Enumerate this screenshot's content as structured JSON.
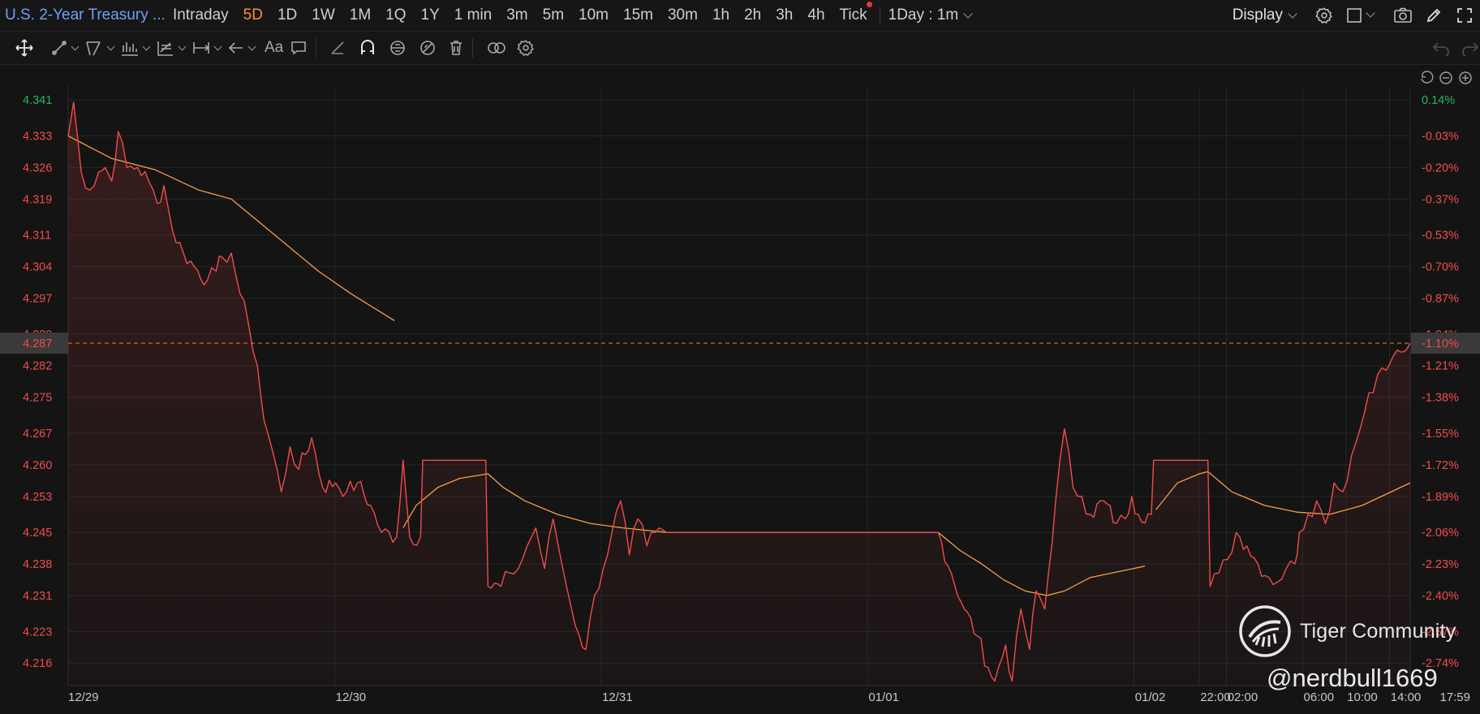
{
  "header": {
    "title": "U.S. 2-Year Treasury ...",
    "timeframes": [
      {
        "label": "Intraday",
        "active": false
      },
      {
        "label": "5D",
        "active": true
      },
      {
        "label": "1D",
        "active": false
      },
      {
        "label": "1W",
        "active": false
      },
      {
        "label": "1M",
        "active": false
      },
      {
        "label": "1Q",
        "active": false
      },
      {
        "label": "1Y",
        "active": false
      },
      {
        "label": "1 min",
        "active": false
      },
      {
        "label": "3m",
        "active": false
      },
      {
        "label": "5m",
        "active": false
      },
      {
        "label": "10m",
        "active": false
      },
      {
        "label": "15m",
        "active": false
      },
      {
        "label": "30m",
        "active": false
      },
      {
        "label": "1h",
        "active": false
      },
      {
        "label": "2h",
        "active": false
      },
      {
        "label": "3h",
        "active": false
      },
      {
        "label": "4h",
        "active": false
      },
      {
        "label": "Tick",
        "active": false
      }
    ],
    "period_select": "1Day : 1m",
    "display_label": "Display"
  },
  "toolbar": {
    "text_tool": "Aa",
    "icons": [
      "move-icon",
      "line-tool-icon",
      "channel-tool-icon",
      "pattern-tool-icon",
      "fib-tool-icon",
      "measure-tool-icon",
      "arrow-tool-icon",
      "text-tool-icon",
      "comment-icon",
      "pencil-icon",
      "magnet-icon",
      "lock-icon",
      "hide-icon",
      "trash-icon",
      "link-icon",
      "settings-icon",
      "undo-icon",
      "redo-icon"
    ]
  },
  "colors": {
    "up": "#25b85a",
    "down": "#f24b4b",
    "avg_line": "#f5a04a",
    "background": "#141414",
    "grid": "#262626",
    "current_price_line": "#f57a3d"
  },
  "chart_data": {
    "type": "line",
    "instrument": "U.S. 2-Year Treasury",
    "y_left_ticks": [
      "4.341",
      "4.333",
      "4.326",
      "4.319",
      "4.311",
      "4.304",
      "4.297",
      "4.289",
      "4.282",
      "4.275",
      "4.267",
      "4.260",
      "4.253",
      "4.245",
      "4.238",
      "4.231",
      "4.223",
      "4.216"
    ],
    "y_right_ticks": [
      "0.14%",
      "-0.03%",
      "-0.20%",
      "-0.37%",
      "-0.53%",
      "-0.70%",
      "-0.87%",
      "-1.04%",
      "-1.21%",
      "-1.38%",
      "-1.55%",
      "-1.72%",
      "-1.89%",
      "-2.06%",
      "-2.23%",
      "-2.40%",
      "-2.57%",
      "-2.74%"
    ],
    "ylim": [
      4.211,
      4.343
    ],
    "current_price": {
      "value": 4.287,
      "label": "4.287",
      "pct": "-1.10%"
    },
    "x_labels": [
      "12/29",
      "12/30",
      "12/31",
      "01/01",
      "01/02",
      "22:00",
      "02:00",
      "06:00",
      "10:00",
      "14:00",
      "17:59"
    ],
    "grid": true,
    "price_series": [
      [
        0,
        4.333
      ],
      [
        0.5,
        4.3405
      ],
      [
        1.2,
        4.325
      ],
      [
        2,
        4.321
      ],
      [
        2.8,
        4.325
      ],
      [
        3.4,
        4.326
      ],
      [
        4,
        4.323
      ],
      [
        4.6,
        4.334
      ],
      [
        5.4,
        4.326
      ],
      [
        6.4,
        4.326
      ],
      [
        7.4,
        4.323
      ],
      [
        8.2,
        4.318
      ],
      [
        8.8,
        4.322
      ],
      [
        9.6,
        4.312
      ],
      [
        10.6,
        4.307
      ],
      [
        11.6,
        4.304
      ],
      [
        12.8,
        4.301
      ],
      [
        13.6,
        4.303
      ],
      [
        14.2,
        4.306
      ],
      [
        15,
        4.307
      ],
      [
        15.8,
        4.298
      ],
      [
        16.6,
        4.291
      ],
      [
        17.4,
        4.282
      ],
      [
        18,
        4.27
      ],
      [
        18.8,
        4.263
      ],
      [
        19.6,
        4.254
      ],
      [
        20.4,
        4.264
      ],
      [
        21.2,
        4.259
      ],
      [
        22.4,
        4.266
      ],
      [
        23.4,
        4.255
      ],
      [
        24.6,
        4.256
      ],
      [
        25.6,
        4.254
      ],
      [
        26.6,
        4.256
      ],
      [
        27.8,
        4.251
      ],
      [
        28.8,
        4.245
      ],
      [
        30.2,
        4.244
      ],
      [
        30.8,
        4.261
      ],
      [
        31.4,
        4.244
      ],
      [
        32.4,
        4.244
      ],
      [
        32.6,
        4.261
      ],
      [
        38.4,
        4.261
      ],
      [
        38.6,
        4.233
      ],
      [
        39.8,
        4.233
      ],
      [
        40.6,
        4.236
      ],
      [
        41.4,
        4.237
      ],
      [
        42.2,
        4.242
      ],
      [
        43,
        4.246
      ],
      [
        43.8,
        4.237
      ],
      [
        44.6,
        4.248
      ],
      [
        45.4,
        4.238
      ],
      [
        46.2,
        4.229
      ],
      [
        47,
        4.222
      ],
      [
        47.6,
        4.219
      ],
      [
        48.4,
        4.231
      ],
      [
        49.2,
        4.237
      ],
      [
        50,
        4.245
      ],
      [
        50.8,
        4.252
      ],
      [
        51.6,
        4.24
      ],
      [
        52.4,
        4.248
      ],
      [
        53.2,
        4.242
      ],
      [
        54,
        4.245
      ],
      [
        55,
        4.245
      ],
      [
        80,
        4.245
      ],
      [
        81.2,
        4.236
      ],
      [
        82.4,
        4.228
      ],
      [
        83.6,
        4.222
      ],
      [
        84.6,
        4.215
      ],
      [
        85.2,
        4.212
      ],
      [
        86.2,
        4.22
      ],
      [
        86.8,
        4.212
      ],
      [
        87.6,
        4.228
      ],
      [
        88.4,
        4.219
      ],
      [
        89,
        4.232
      ],
      [
        89.8,
        4.228
      ],
      [
        90.8,
        4.252
      ],
      [
        91.6,
        4.268
      ],
      [
        92.4,
        4.255
      ],
      [
        93.2,
        4.253
      ],
      [
        94,
        4.249
      ],
      [
        95.2,
        4.252
      ],
      [
        96.4,
        4.247
      ],
      [
        97.2,
        4.248
      ],
      [
        97.8,
        4.253
      ],
      [
        98.4,
        4.249
      ],
      [
        99.6,
        4.249
      ],
      [
        99.8,
        4.261
      ],
      [
        104.8,
        4.261
      ],
      [
        105,
        4.233
      ],
      [
        105.8,
        4.236
      ],
      [
        106.6,
        4.239
      ],
      [
        107.4,
        4.245
      ],
      [
        108.4,
        4.242
      ],
      [
        109.4,
        4.238
      ],
      [
        110.4,
        4.235
      ],
      [
        111.2,
        4.234
      ],
      [
        112,
        4.237
      ],
      [
        112.8,
        4.238
      ],
      [
        113.2,
        4.245
      ],
      [
        114,
        4.249
      ],
      [
        114.8,
        4.252
      ],
      [
        115.6,
        4.247
      ],
      [
        116.4,
        4.256
      ],
      [
        117.2,
        4.254
      ],
      [
        118,
        4.262
      ],
      [
        118.8,
        4.268
      ],
      [
        119.6,
        4.276
      ],
      [
        120.4,
        4.28
      ],
      [
        121.2,
        4.281
      ],
      [
        121.8,
        4.284
      ],
      [
        122.6,
        4.285
      ],
      [
        123.4,
        4.287
      ]
    ],
    "avg_series_segments": [
      [
        [
          0,
          4.333
        ],
        [
          4,
          4.328
        ],
        [
          8,
          4.3255
        ],
        [
          12,
          4.321
        ],
        [
          15,
          4.319
        ],
        [
          17,
          4.315
        ],
        [
          20,
          4.309
        ],
        [
          23,
          4.303
        ],
        [
          26,
          4.298
        ],
        [
          30,
          4.292
        ]
      ],
      [
        [
          30.8,
          4.246
        ],
        [
          32,
          4.251
        ],
        [
          34,
          4.255
        ],
        [
          36,
          4.257
        ],
        [
          38.6,
          4.258
        ],
        [
          40,
          4.255
        ],
        [
          42,
          4.252
        ],
        [
          45,
          4.249
        ],
        [
          48,
          4.247
        ],
        [
          51,
          4.246
        ],
        [
          55,
          4.245
        ]
      ],
      [
        [
          55,
          4.245
        ],
        [
          80,
          4.245
        ],
        [
          82,
          4.241
        ],
        [
          84,
          4.238
        ],
        [
          86,
          4.2345
        ],
        [
          88,
          4.232
        ],
        [
          90,
          4.231
        ],
        [
          91.6,
          4.232
        ],
        [
          94,
          4.235
        ],
        [
          99,
          4.2375
        ]
      ],
      [
        [
          100,
          4.25
        ],
        [
          102,
          4.256
        ],
        [
          104,
          4.258
        ],
        [
          104.8,
          4.2585
        ],
        [
          107,
          4.254
        ],
        [
          110,
          4.251
        ],
        [
          113,
          4.2495
        ],
        [
          116,
          4.249
        ],
        [
          119,
          4.251
        ],
        [
          123.4,
          4.256
        ]
      ]
    ],
    "x_tick_positions": [
      0,
      24.5,
      49,
      73.5,
      98,
      104,
      106.5,
      113.5,
      117.5,
      121.5,
      123.4
    ]
  },
  "watermark": {
    "brand": "Tiger Community",
    "handle": "@nerdbull1669"
  }
}
